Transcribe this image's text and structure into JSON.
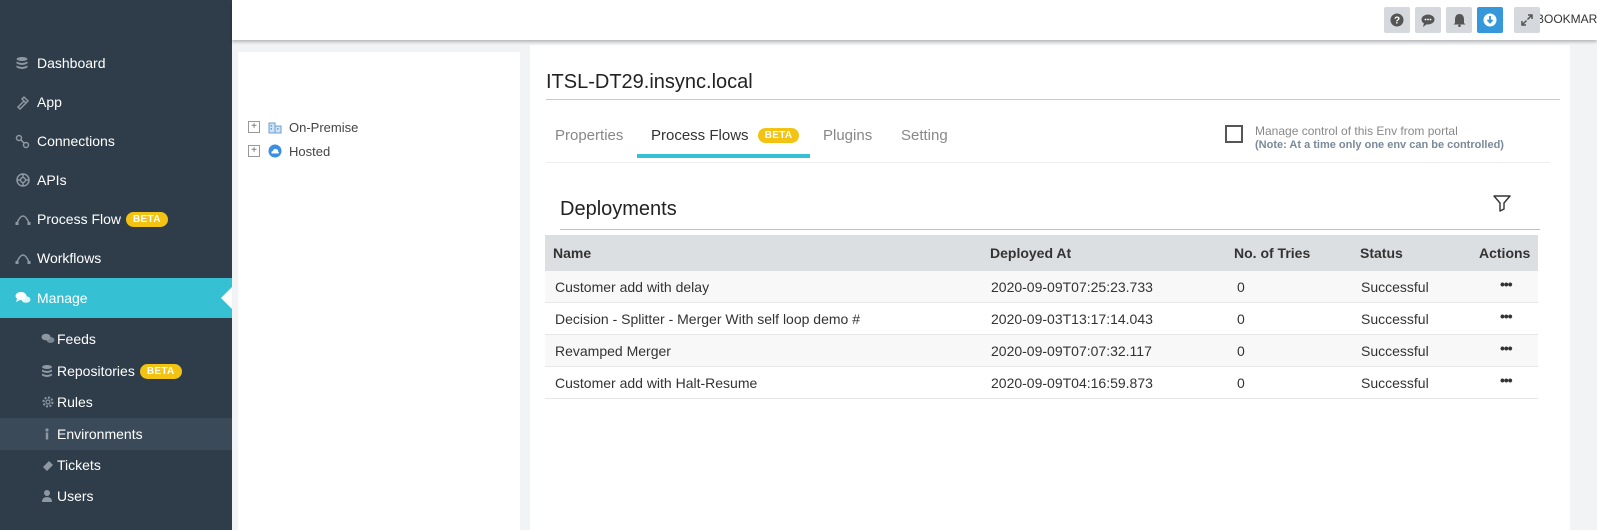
{
  "sidebar": {
    "items": [
      {
        "label": "Dashboard",
        "icon": "database-icon"
      },
      {
        "label": "App",
        "icon": "app-icon"
      },
      {
        "label": "Connections",
        "icon": "connections-icon"
      },
      {
        "label": "APIs",
        "icon": "apis-icon"
      },
      {
        "label": "Process Flow",
        "icon": "process-flow-icon",
        "badge": "BETA"
      },
      {
        "label": "Workflows",
        "icon": "workflows-icon"
      },
      {
        "label": "Manage",
        "icon": "comments-icon"
      }
    ],
    "sub_items": [
      {
        "label": "Feeds",
        "icon": "feeds-icon"
      },
      {
        "label": "Repositories",
        "icon": "repositories-icon",
        "badge": "BETA"
      },
      {
        "label": "Rules",
        "icon": "gear-icon"
      },
      {
        "label": "Environments",
        "icon": "info-icon"
      },
      {
        "label": "Tickets",
        "icon": "ticket-icon"
      },
      {
        "label": "Users",
        "icon": "user-icon"
      }
    ]
  },
  "topbar": {
    "bookmarks_label": "BOOKMARKS",
    "buttons": [
      "help-icon",
      "chat-icon",
      "bell-icon",
      "download-icon",
      "expand-icon"
    ]
  },
  "tree": {
    "nodes": [
      {
        "label": "On-Premise",
        "expander": "+"
      },
      {
        "label": "Hosted",
        "expander": "+"
      }
    ]
  },
  "main": {
    "env_title": "ITSL-DT29.insync.local",
    "tabs": [
      {
        "label": "Properties"
      },
      {
        "label": "Process Flows",
        "badge": "BETA"
      },
      {
        "label": "Plugins"
      },
      {
        "label": "Setting"
      }
    ],
    "manage_control": {
      "label": "Manage control of this Env from portal",
      "note": "(Note: At a time only one env can be controlled)"
    },
    "deployments": {
      "title": "Deployments",
      "columns": [
        "Name",
        "Deployed At",
        "No. of Tries",
        "Status",
        "Actions"
      ],
      "rows": [
        {
          "name": "Customer add with delay",
          "deployed_at": "2020-09-09T07:25:23.733",
          "tries": "0",
          "status": "Successful",
          "actions": "•••"
        },
        {
          "name": "Decision - Splitter - Merger With self loop demo #",
          "deployed_at": "2020-09-03T13:17:14.043",
          "tries": "0",
          "status": "Successful",
          "actions": "•••"
        },
        {
          "name": "Revamped Merger",
          "deployed_at": "2020-09-09T07:07:32.117",
          "tries": "0",
          "status": "Successful",
          "actions": "•••"
        },
        {
          "name": "Customer add with Halt-Resume",
          "deployed_at": "2020-09-09T04:16:59.873",
          "tries": "0",
          "status": "Successful",
          "actions": "•••"
        }
      ]
    }
  },
  "colors": {
    "sidebar_bg": "#2f3d4a",
    "accent": "#36c0d4",
    "beta_badge": "#f2c313",
    "primary_button": "#3498db"
  }
}
